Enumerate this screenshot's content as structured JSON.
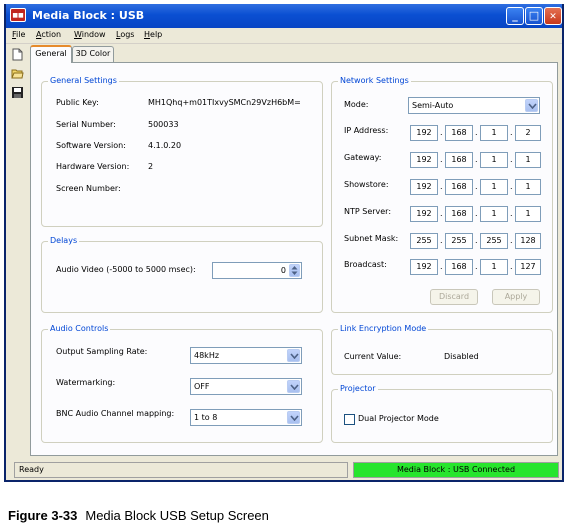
{
  "window": {
    "title": "Media Block : USB",
    "icon_text": "■■",
    "buttons": {
      "minimize": "_",
      "maximize": "□",
      "close": "✕"
    }
  },
  "menu": [
    {
      "label": "File",
      "accel": "F",
      "rest": "ile"
    },
    {
      "label": "Action",
      "accel": "A",
      "rest": "ction"
    },
    {
      "label": "Window",
      "accel": "W",
      "rest": "indow"
    },
    {
      "label": "Logs",
      "accel": "L",
      "rest": "ogs"
    },
    {
      "label": "Help",
      "accel": "H",
      "rest": "elp"
    }
  ],
  "toolbar_icons": [
    "new-document-icon",
    "open-folder-icon",
    "save-disk-icon"
  ],
  "tabs": [
    {
      "label": "General",
      "active": true
    },
    {
      "label": "3D Color",
      "active": false
    }
  ],
  "general_settings": {
    "title": "General Settings",
    "rows": [
      {
        "label": "Public Key:",
        "value": "MH1Qhq+m01TIxvySMCn29VzH6bM="
      },
      {
        "label": "Serial Number:",
        "value": "500033"
      },
      {
        "label": "Software Version:",
        "value": "4.1.0.20"
      },
      {
        "label": "Hardware Version:",
        "value": "2"
      },
      {
        "label": "Screen Number:",
        "value": ""
      }
    ]
  },
  "delays": {
    "title": "Delays",
    "audio_video_label": "Audio Video (-5000 to 5000  msec):",
    "audio_video_value": "0"
  },
  "audio_controls": {
    "title": "Audio Controls",
    "output_sampling_label": "Output Sampling Rate:",
    "output_sampling_value": "48kHz",
    "watermarking_label": "Watermarking:",
    "watermarking_value": "OFF",
    "bnc_label": "BNC Audio Channel mapping:",
    "bnc_value": "1 to 8"
  },
  "network_settings": {
    "title": "Network Settings",
    "mode_label": "Mode:",
    "mode_value": "Semi-Auto",
    "rows": [
      {
        "label": "IP Address:",
        "octets": [
          "192",
          "168",
          "1",
          "2"
        ]
      },
      {
        "label": "Gateway:",
        "octets": [
          "192",
          "168",
          "1",
          "1"
        ]
      },
      {
        "label": "Showstore:",
        "octets": [
          "192",
          "168",
          "1",
          "1"
        ]
      },
      {
        "label": "NTP Server:",
        "octets": [
          "192",
          "168",
          "1",
          "1"
        ]
      },
      {
        "label": "Subnet Mask:",
        "octets": [
          "255",
          "255",
          "255",
          "128"
        ]
      },
      {
        "label": "Broadcast:",
        "octets": [
          "192",
          "168",
          "1",
          "127"
        ]
      }
    ],
    "discard_label": "Discard",
    "apply_label": "Apply"
  },
  "link_encryption": {
    "title": "Link Encryption Mode",
    "current_label": "Current Value:",
    "current_value": "Disabled"
  },
  "projector": {
    "title": "Projector",
    "dual_label": "Dual Projector Mode",
    "dual_checked": false
  },
  "status": {
    "left": "Ready",
    "right": "Media Block : USB Connected",
    "right_color": "#27e52d"
  },
  "caption": {
    "number": "Figure 3-33",
    "text": "Media Block USB Setup Screen"
  }
}
